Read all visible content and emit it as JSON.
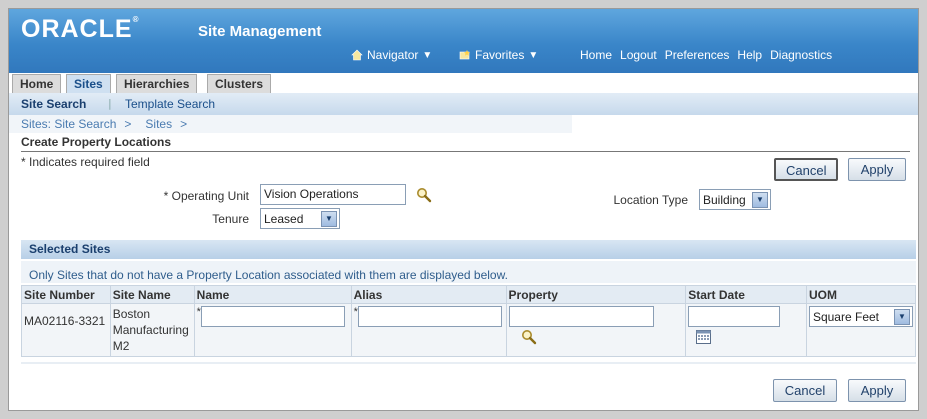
{
  "header": {
    "logo": "ORACLE",
    "app_title": "Site Management",
    "navigator_label": "Navigator",
    "favorites_label": "Favorites",
    "global_links": [
      "Home",
      "Logout",
      "Preferences",
      "Help",
      "Diagnostics"
    ]
  },
  "tabs": [
    {
      "label": "Home",
      "active": false
    },
    {
      "label": "Sites",
      "active": true
    },
    {
      "label": "Hierarchies",
      "active": false
    },
    {
      "label": "Clusters",
      "active": false
    }
  ],
  "subtabs": {
    "site_search": "Site Search",
    "separator": "|",
    "template_search": "Template Search"
  },
  "breadcrumb": {
    "item1": "Sites: Site Search",
    "sep1": ">",
    "item2": "Sites",
    "sep2": ">"
  },
  "page": {
    "title": "Create Property Locations",
    "required_note": "* Indicates required field",
    "cancel_label": "Cancel",
    "apply_label": "Apply"
  },
  "form": {
    "operating_unit_label": "* Operating Unit",
    "operating_unit_value": "Vision Operations",
    "tenure_label": "Tenure",
    "tenure_value": "Leased",
    "location_type_label": "Location Type",
    "location_type_value": "Building"
  },
  "selected_sites": {
    "title": "Selected Sites",
    "note": "Only Sites that do not have a Property Location associated with them are displayed below.",
    "columns": [
      "Site Number",
      "Site Name",
      "Name",
      "Alias",
      "Property",
      "Start Date",
      "UOM"
    ],
    "rows": [
      {
        "site_number": "MA02116-3321",
        "site_name": "Boston Manufacturing M2",
        "name": "",
        "alias": "",
        "property": "",
        "start_date": "",
        "uom": "Square Feet"
      }
    ]
  },
  "colors": {
    "header_blue": "#3a86c9",
    "link_blue": "#4a7bb0",
    "section_header": "#b7cfe7"
  }
}
